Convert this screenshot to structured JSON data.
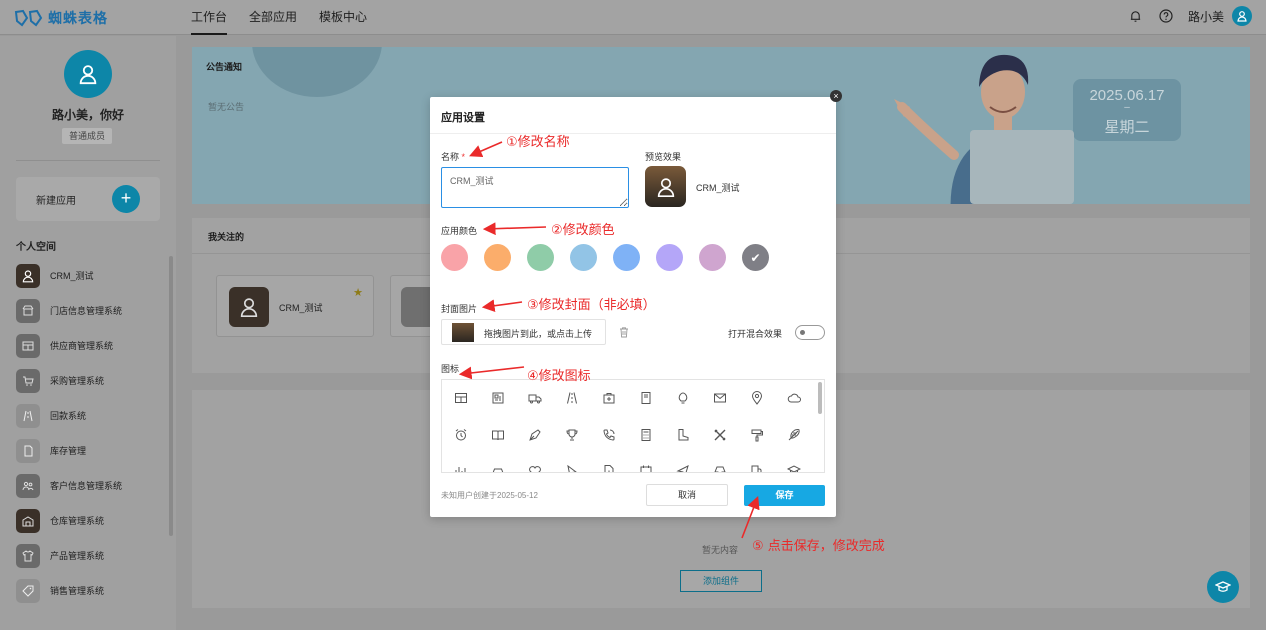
{
  "brand": {
    "name": "蜘蛛表格",
    "accent": "#17a8e3"
  },
  "nav": [
    "工作台",
    "全部应用",
    "模板中心"
  ],
  "user": {
    "name": "路小美"
  },
  "sidebar": {
    "greeting": "路小美，你好",
    "role": "普通成员",
    "new_app": "新建应用",
    "new_app_plus": "+",
    "space_title": "个人空间",
    "apps": [
      {
        "name": "CRM_测试"
      },
      {
        "name": "门店信息管理系统"
      },
      {
        "name": "供应商管理系统"
      },
      {
        "name": "采购管理系统"
      },
      {
        "name": "回款系统"
      },
      {
        "name": "库存管理"
      },
      {
        "name": "客户信息管理系统"
      },
      {
        "name": "仓库管理系统"
      },
      {
        "name": "产品管理系统"
      },
      {
        "name": "销售管理系统"
      }
    ]
  },
  "notice": {
    "title": "公告通知",
    "empty": "暂无公告",
    "date": "2025.06.17",
    "dash": "–",
    "weekday": "星期二"
  },
  "follow": {
    "title": "我关注的",
    "card_name": "CRM_测试",
    "star": "★"
  },
  "widgets": {
    "empty": "暂无内容",
    "add": "添加组件"
  },
  "dialog": {
    "title": "应用设置",
    "close": "×",
    "name_label": "名称",
    "required_mark": "*",
    "name_value": "CRM_测试",
    "preview_label": "预览效果",
    "preview_name": "CRM_测试",
    "color_label": "应用颜色",
    "colors": [
      "#f9a3a8",
      "#fbad6b",
      "#8fcca8",
      "#92c4e6",
      "#7fb2f6",
      "#b4a6f8",
      "#cfa5cf",
      "#7f7f86"
    ],
    "selected_check": "✔",
    "cover_label": "封面图片",
    "cover_text": "拖拽图片到此，或点击上传",
    "blend_label": "打开混合效果",
    "icon_label": "图标",
    "footer_note": "未知用户创建于2025-05-12",
    "cancel": "取消",
    "save": "保存"
  },
  "annotations": {
    "step1": "①修改名称",
    "step2": "②修改颜色",
    "step3": "③修改封面（非必填）",
    "step4": "④修改图标",
    "step5": "⑤ 点击保存，修改完成",
    "color": "#ea2a2a"
  }
}
